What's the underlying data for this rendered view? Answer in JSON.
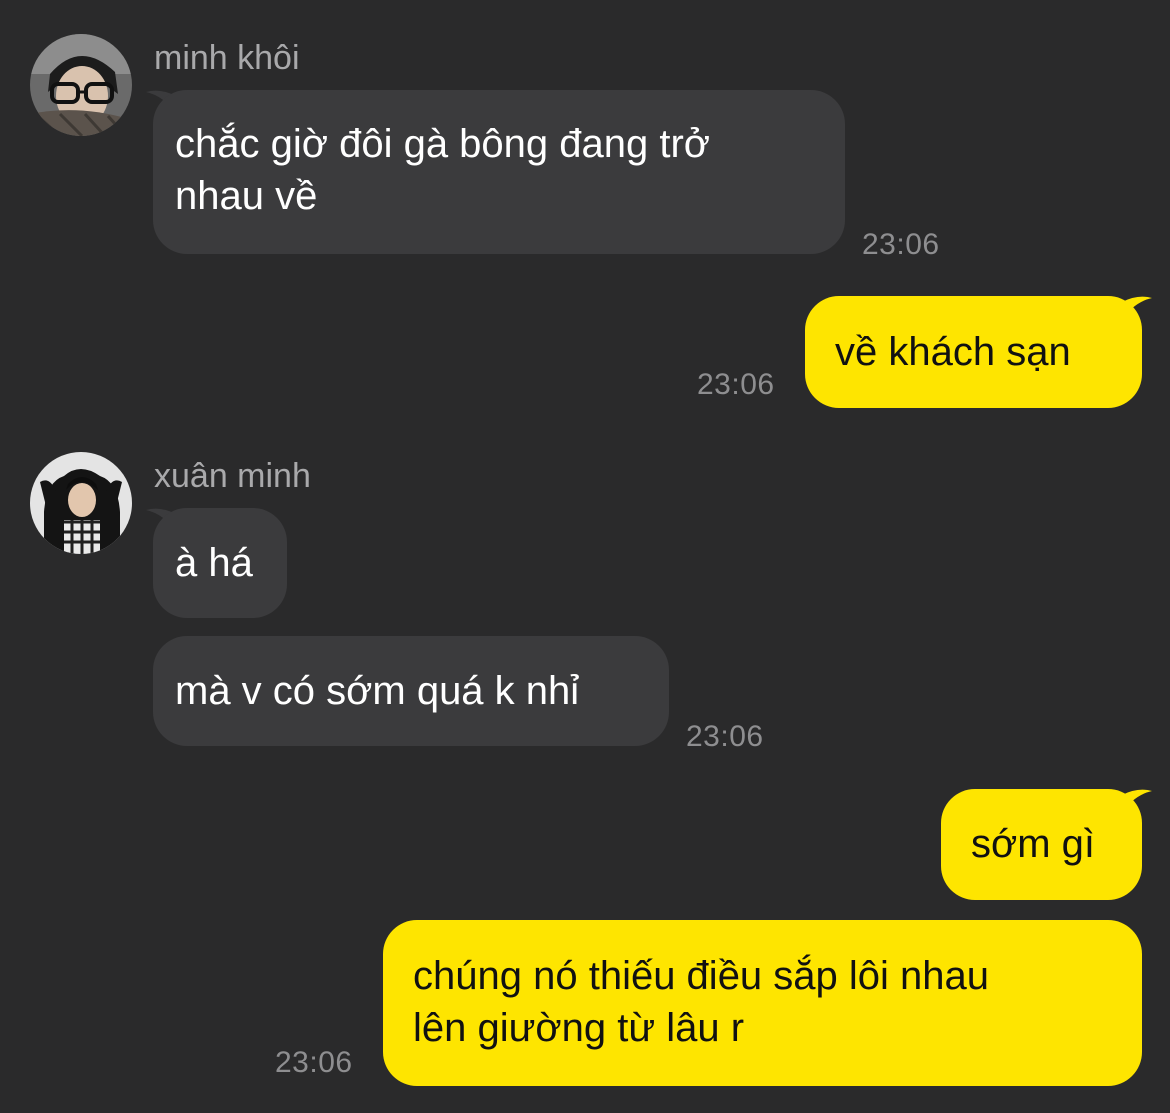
{
  "messages": [
    {
      "sender": "minh khôi",
      "direction": "incoming",
      "lines": [
        "chắc giờ đôi gà bông đang trở",
        "nhau về"
      ],
      "time": "23:06"
    },
    {
      "direction": "outgoing",
      "lines": [
        "về khách sạn"
      ],
      "time": "23:06"
    },
    {
      "sender": "xuân minh",
      "direction": "incoming",
      "lines": [
        "à há"
      ]
    },
    {
      "direction": "incoming",
      "lines": [
        "mà v có sớm quá k nhỉ"
      ],
      "time": "23:06"
    },
    {
      "direction": "outgoing",
      "lines": [
        "sớm gì"
      ]
    },
    {
      "direction": "outgoing",
      "lines": [
        "chúng nó thiếu điều sắp lôi nhau",
        "lên giường từ lâu r"
      ],
      "time": "23:06"
    }
  ],
  "colors": {
    "background": "#2a2a2b",
    "incoming_bubble": "#3b3b3d",
    "outgoing_bubble": "#fee500",
    "sender_name": "#a9a9ab",
    "timestamp": "#8e8e90"
  },
  "icons": {
    "avatar_1": "profile-photo-sunglasses",
    "avatar_2": "profile-photo-hooded-jacket"
  }
}
